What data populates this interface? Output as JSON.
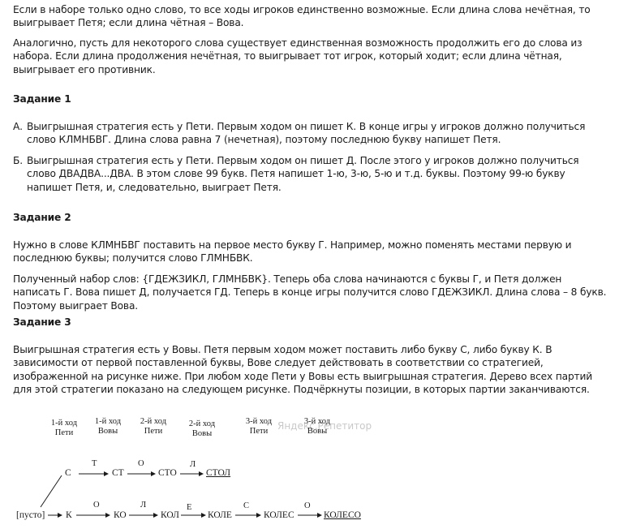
{
  "paragraphs": {
    "p1": "Если в наборе только одно слово, то все ходы игроков единственно возможные. Если длина слова нечётная, то выигрывает Петя; если длина чётная – Вова.",
    "p2": "Аналогично, пусть для некоторого слова существует единственная возможность продолжить его до слова из набора. Если длина продолжения нечётная, то выигрывает тот игрок, который ходит; если длина чётная, выигрывает его противник."
  },
  "task1": {
    "heading": "Задание 1",
    "a_marker": "А.",
    "a_text": "Выигрышная стратегия есть у Пети. Первым ходом он пишет К. В конце игры у игроков должно получиться слово КЛМНБВГ. Длина слова равна 7 (нечетная), поэтому последнюю букву напишет Петя.",
    "b_marker": "Б.",
    "b_text": "Выигрышная стратегия есть у Пети. Первым ходом он пишет Д. После этого у игроков должно получиться слово ДВАДВА...ДВА. В этом слове 99 букв. Петя напишет 1-ю, 3-ю, 5-ю и т.д. буквы. Поэтому 99-ю букву напишет Петя, и, следовательно, выиграет Петя."
  },
  "task2": {
    "heading": "Задание 2",
    "p1": "Нужно в слове КЛМНБВГ поставить на первое место букву Г. Например, можно поменять местами первую и последнюю буквы; получится слово ГЛМНБВК.",
    "p2": "Полученный набор слов: {ГДЕЖЗИКЛ, ГЛМНБВК}. Теперь оба слова начинаются с буквы Г, и Петя должен написать Г. Вова пишет Д, получается ГД. Теперь в конце игры получится слово ГДЕЖЗИКЛ. Длина слова – 8 букв. Поэтому выиграет Вова."
  },
  "task3": {
    "heading": "Задание 3",
    "p1": "Выигрышная стратегия есть у Вовы. Петя первым ходом может поставить либо букву С, либо букву К. В зависимости от первой поставленной буквы, Вове следует действовать в соответствии со стратегией, изображенной на рисунке ниже. При любом ходе Пети у Вовы есть выигрышная стратегия. Дерево всех партий для этой стратегии показано на следующем рисунке. Подчёркнуты позиции, в которых партии заканчиваются."
  },
  "tree": {
    "headers": [
      {
        "move": "1-й ход",
        "player": "Пети"
      },
      {
        "move": "1-й ход",
        "player": "Вовы"
      },
      {
        "move": "2-й ход",
        "player": "Пети"
      },
      {
        "move": "2-й ход",
        "player": "Вовы"
      },
      {
        "move": "3-й ход",
        "player": "Пети"
      },
      {
        "move": "3-й ход",
        "player": "Вовы"
      }
    ],
    "root": "[пусто]",
    "upper": {
      "nodes": [
        "С",
        "СТ",
        "СТО",
        "СТОЛ"
      ],
      "edges": [
        "Т",
        "О",
        "Л"
      ]
    },
    "lower": {
      "nodes": [
        "К",
        "КО",
        "КОЛ",
        "КОЛЕ",
        "КОЛЕС",
        "КОЛЕСО"
      ],
      "edges": [
        "О",
        "Л",
        "Е",
        "С",
        "О"
      ]
    },
    "watermark": "Яндекс.Репетитор"
  }
}
